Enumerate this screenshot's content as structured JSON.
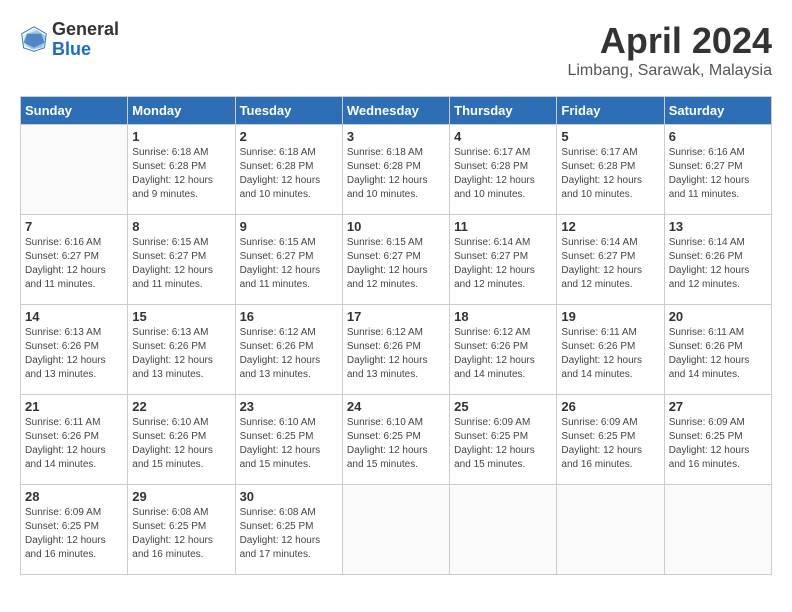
{
  "header": {
    "logo_general": "General",
    "logo_blue": "Blue",
    "month_title": "April 2024",
    "location": "Limbang, Sarawak, Malaysia"
  },
  "weekdays": [
    "Sunday",
    "Monday",
    "Tuesday",
    "Wednesday",
    "Thursday",
    "Friday",
    "Saturday"
  ],
  "weeks": [
    [
      null,
      {
        "day": 1,
        "sunrise": "6:18 AM",
        "sunset": "6:28 PM",
        "daylight": "12 hours and 9 minutes."
      },
      {
        "day": 2,
        "sunrise": "6:18 AM",
        "sunset": "6:28 PM",
        "daylight": "12 hours and 10 minutes."
      },
      {
        "day": 3,
        "sunrise": "6:18 AM",
        "sunset": "6:28 PM",
        "daylight": "12 hours and 10 minutes."
      },
      {
        "day": 4,
        "sunrise": "6:17 AM",
        "sunset": "6:28 PM",
        "daylight": "12 hours and 10 minutes."
      },
      {
        "day": 5,
        "sunrise": "6:17 AM",
        "sunset": "6:28 PM",
        "daylight": "12 hours and 10 minutes."
      },
      {
        "day": 6,
        "sunrise": "6:16 AM",
        "sunset": "6:27 PM",
        "daylight": "12 hours and 11 minutes."
      }
    ],
    [
      {
        "day": 7,
        "sunrise": "6:16 AM",
        "sunset": "6:27 PM",
        "daylight": "12 hours and 11 minutes."
      },
      {
        "day": 8,
        "sunrise": "6:15 AM",
        "sunset": "6:27 PM",
        "daylight": "12 hours and 11 minutes."
      },
      {
        "day": 9,
        "sunrise": "6:15 AM",
        "sunset": "6:27 PM",
        "daylight": "12 hours and 11 minutes."
      },
      {
        "day": 10,
        "sunrise": "6:15 AM",
        "sunset": "6:27 PM",
        "daylight": "12 hours and 12 minutes."
      },
      {
        "day": 11,
        "sunrise": "6:14 AM",
        "sunset": "6:27 PM",
        "daylight": "12 hours and 12 minutes."
      },
      {
        "day": 12,
        "sunrise": "6:14 AM",
        "sunset": "6:27 PM",
        "daylight": "12 hours and 12 minutes."
      },
      {
        "day": 13,
        "sunrise": "6:14 AM",
        "sunset": "6:26 PM",
        "daylight": "12 hours and 12 minutes."
      }
    ],
    [
      {
        "day": 14,
        "sunrise": "6:13 AM",
        "sunset": "6:26 PM",
        "daylight": "12 hours and 13 minutes."
      },
      {
        "day": 15,
        "sunrise": "6:13 AM",
        "sunset": "6:26 PM",
        "daylight": "12 hours and 13 minutes."
      },
      {
        "day": 16,
        "sunrise": "6:12 AM",
        "sunset": "6:26 PM",
        "daylight": "12 hours and 13 minutes."
      },
      {
        "day": 17,
        "sunrise": "6:12 AM",
        "sunset": "6:26 PM",
        "daylight": "12 hours and 13 minutes."
      },
      {
        "day": 18,
        "sunrise": "6:12 AM",
        "sunset": "6:26 PM",
        "daylight": "12 hours and 14 minutes."
      },
      {
        "day": 19,
        "sunrise": "6:11 AM",
        "sunset": "6:26 PM",
        "daylight": "12 hours and 14 minutes."
      },
      {
        "day": 20,
        "sunrise": "6:11 AM",
        "sunset": "6:26 PM",
        "daylight": "12 hours and 14 minutes."
      }
    ],
    [
      {
        "day": 21,
        "sunrise": "6:11 AM",
        "sunset": "6:26 PM",
        "daylight": "12 hours and 14 minutes."
      },
      {
        "day": 22,
        "sunrise": "6:10 AM",
        "sunset": "6:26 PM",
        "daylight": "12 hours and 15 minutes."
      },
      {
        "day": 23,
        "sunrise": "6:10 AM",
        "sunset": "6:25 PM",
        "daylight": "12 hours and 15 minutes."
      },
      {
        "day": 24,
        "sunrise": "6:10 AM",
        "sunset": "6:25 PM",
        "daylight": "12 hours and 15 minutes."
      },
      {
        "day": 25,
        "sunrise": "6:09 AM",
        "sunset": "6:25 PM",
        "daylight": "12 hours and 15 minutes."
      },
      {
        "day": 26,
        "sunrise": "6:09 AM",
        "sunset": "6:25 PM",
        "daylight": "12 hours and 16 minutes."
      },
      {
        "day": 27,
        "sunrise": "6:09 AM",
        "sunset": "6:25 PM",
        "daylight": "12 hours and 16 minutes."
      }
    ],
    [
      {
        "day": 28,
        "sunrise": "6:09 AM",
        "sunset": "6:25 PM",
        "daylight": "12 hours and 16 minutes."
      },
      {
        "day": 29,
        "sunrise": "6:08 AM",
        "sunset": "6:25 PM",
        "daylight": "12 hours and 16 minutes."
      },
      {
        "day": 30,
        "sunrise": "6:08 AM",
        "sunset": "6:25 PM",
        "daylight": "12 hours and 17 minutes."
      },
      null,
      null,
      null,
      null
    ]
  ]
}
